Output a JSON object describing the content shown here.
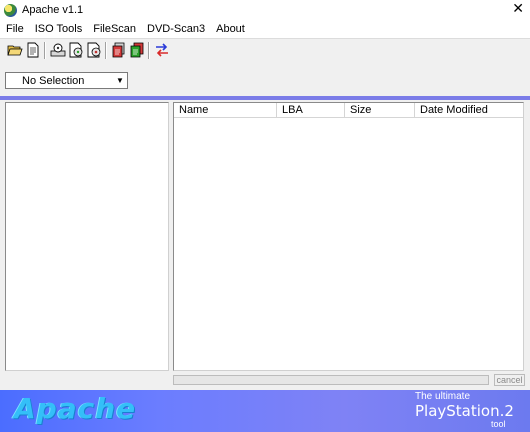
{
  "window": {
    "title": "Apache v1.1",
    "close_glyph": "✕"
  },
  "menu": {
    "items": [
      "File",
      "ISO Tools",
      "FileScan",
      "DVD-Scan3",
      "About"
    ]
  },
  "toolbar": {
    "icons": [
      "open-folder-icon",
      "document-icon",
      "disc-search-icon",
      "disc-file-icon",
      "disc-scan-icon",
      "red-document-icon",
      "green-document-icon",
      "swap-arrows-icon"
    ]
  },
  "selector": {
    "value": "No Selection",
    "arrow": "▼"
  },
  "file_list": {
    "columns": [
      "Name",
      "LBA",
      "Size",
      "Date Modified"
    ]
  },
  "progress": {
    "value": 0
  },
  "cancel_label": "cancel",
  "banner": {
    "logo_text": "Apache",
    "tagline": "The ultimate",
    "product": "PlayStation.2",
    "suffix": "tool"
  },
  "colors": {
    "accent_strip": "#7b7ce8",
    "banner": "#6b7dff"
  }
}
